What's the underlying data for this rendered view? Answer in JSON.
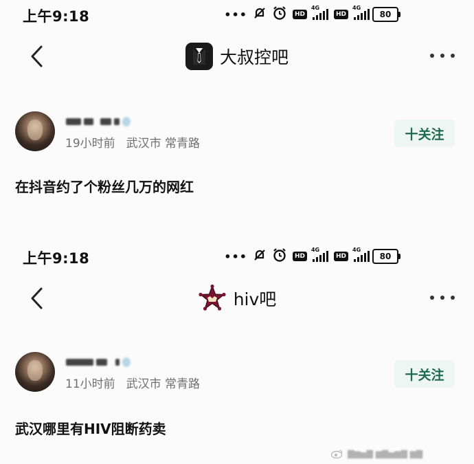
{
  "screenshots": [
    {
      "status": {
        "time": "上午9:18",
        "dots": "•••",
        "network": "4G",
        "hd": "HD",
        "battery": "80"
      },
      "nav": {
        "forum_name": "大叔控吧",
        "forum_icon": "suit-tie-logo",
        "back_icon": "back-chevron-icon",
        "more_icon": "more-dots-icon"
      },
      "post": {
        "time_ago": "19小时前",
        "city": "武汉市",
        "street": "常青路",
        "follow_label": "十关注",
        "content": "在抖音约了个粉丝几万的网红"
      }
    },
    {
      "status": {
        "time": "上午9:18",
        "dots": "•••",
        "network": "4G",
        "hd": "HD",
        "battery": "80"
      },
      "nav": {
        "forum_name": "hiv吧",
        "forum_icon": "star-badge-logo",
        "back_icon": "back-chevron-icon",
        "more_icon": "more-dots-icon"
      },
      "post": {
        "time_ago": "11小时前",
        "city": "武汉市",
        "street": "常青路",
        "follow_label": "十关注",
        "content": "武汉哪里有HIV阻断药卖"
      }
    }
  ],
  "colors": {
    "follow_bg": "#eef6f3",
    "follow_text": "#1f6a4e",
    "logo_star": "#7a1530"
  }
}
